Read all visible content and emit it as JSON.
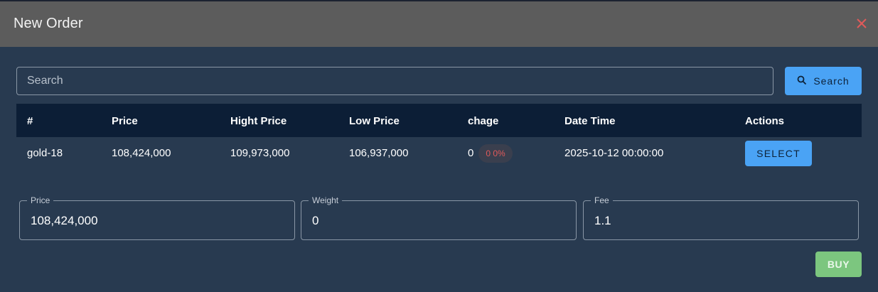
{
  "dialog": {
    "title": "New Order",
    "close_icon": "close-icon"
  },
  "search": {
    "placeholder": "Search",
    "value": "",
    "button_label": "Search",
    "button_icon": "search-icon"
  },
  "table": {
    "headers": [
      "#",
      "Price",
      "Hight Price",
      "Low Price",
      "chage",
      "Date Time",
      "Actions"
    ],
    "rows": [
      {
        "id": "gold-18",
        "price": "108,424,000",
        "high_price": "109,973,000",
        "low_price": "106,937,000",
        "change": "0",
        "change_badge": "0 0%",
        "date_time": "2025-10-12 00:00:00",
        "action_label": "SELECT"
      }
    ]
  },
  "form": {
    "price": {
      "label": "Price",
      "value": "108,424,000"
    },
    "weight": {
      "label": "Weight",
      "value": "0"
    },
    "fee": {
      "label": "Fee",
      "value": "1.1"
    }
  },
  "buy_button": "BUY",
  "colors": {
    "header_bg": "#5c5c5c",
    "body_bg": "#283a50",
    "table_head_bg": "#0c1e36",
    "accent_blue": "#4aa3f5",
    "buy_green": "#7cc67f",
    "close_red": "#e05a5a",
    "negative_red": "#e05a5a"
  }
}
